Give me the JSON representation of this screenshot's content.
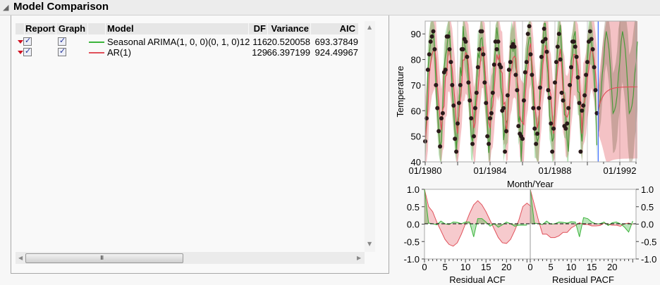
{
  "header": {
    "title": "Model Comparison",
    "disclosure_icon": "triangle-open"
  },
  "table": {
    "columns": [
      "Report",
      "Graph",
      "Model",
      "DF",
      "Variance",
      "AIC"
    ],
    "rows": [
      {
        "report": true,
        "graph": true,
        "color": "#3cb43c",
        "model": "Seasonal ARIMA(1, 0, 0)(0, 1, 0)12",
        "df": "116",
        "variance": "20.520058",
        "aic": "693.37849"
      },
      {
        "report": true,
        "graph": true,
        "color": "#e0505a",
        "model": "AR(1)",
        "df": "129",
        "variance": "66.397199",
        "aic": "924.49967"
      }
    ],
    "scroll": {
      "grip": "III"
    }
  },
  "chart_data": [
    {
      "type": "line",
      "xlabel": "Month/Year",
      "ylabel": "Temperature",
      "xticks": [
        "01/1980",
        "01/1984",
        "01/1988",
        "01/1992"
      ],
      "yticks": [
        40,
        50,
        60,
        70,
        80,
        90
      ],
      "ylim": [
        40,
        95
      ],
      "xlim": [
        "01/1980",
        "07/1993"
      ],
      "forecast_start": "01/1991",
      "observed_start": "01/1980",
      "observed": [
        48,
        57,
        76,
        82,
        87,
        89,
        91,
        84,
        70,
        61,
        52,
        46,
        57,
        59,
        75,
        76,
        89,
        89,
        84,
        79,
        70,
        62,
        49,
        44,
        55,
        63,
        70,
        84,
        84,
        88,
        87,
        81,
        71,
        64,
        57,
        47,
        50,
        61,
        67,
        77,
        84,
        91,
        91,
        82,
        71,
        63,
        50,
        47,
        57,
        59,
        67,
        78,
        87,
        84,
        87,
        78,
        77,
        60,
        61,
        44,
        52,
        66,
        76,
        79,
        85,
        86,
        85,
        74,
        68,
        54,
        51,
        50,
        49,
        64,
        75,
        79,
        90,
        93,
        82,
        74,
        61,
        53,
        47,
        51,
        61,
        69,
        81,
        87,
        92,
        88,
        83,
        68,
        65,
        55,
        44,
        53,
        71,
        79,
        85,
        90,
        80,
        67,
        64,
        54,
        53,
        55,
        61,
        70,
        77,
        87,
        87,
        85,
        81,
        73,
        63,
        44,
        60,
        62,
        66,
        74,
        79,
        87,
        91,
        88,
        84,
        77,
        68,
        59
      ],
      "series": [
        {
          "name": "Seasonal ARIMA(1, 0, 0)(0, 1, 0)12",
          "color": "#3cb43c"
        },
        {
          "name": "AR(1)",
          "color": "#e0505a"
        }
      ],
      "point_color": "#2a1a1a",
      "forecast_line_color": "#3366ff"
    },
    {
      "type": "area",
      "xlabel": "Residual ACF",
      "xticks": [
        0,
        5,
        10,
        15,
        20
      ],
      "ylim": [
        -1,
        1
      ],
      "yticks": [
        "1.0",
        "0.5",
        "0.0",
        "-0.5",
        "-1.0"
      ],
      "series": [
        {
          "name": "AR(1)",
          "color": "#e0505a",
          "values": [
            1,
            0.5,
            0.35,
            0.05,
            -0.2,
            -0.45,
            -0.6,
            -0.65,
            -0.55,
            -0.3,
            0.0,
            0.3,
            0.55,
            0.67,
            0.55,
            0.35,
            0.1,
            -0.15,
            -0.4,
            -0.55,
            -0.57,
            -0.45,
            -0.2,
            0.1,
            0.5,
            0.6,
            0.5
          ]
        },
        {
          "name": "Seasonal ARIMA(1, 0, 0)(0, 1, 0)12",
          "color": "#3cb43c",
          "values": [
            1,
            0.02,
            0,
            -0.03,
            0.08,
            0.0,
            -0.02,
            0.05,
            0.04,
            0.0,
            0.05,
            0.05,
            -0.38,
            0.15,
            0.15,
            0.05,
            -0.07,
            0.0,
            -0.1,
            -0.03,
            0.05,
            0.0,
            -0.07,
            -0.04,
            -0.04,
            -0.04
          ]
        }
      ]
    },
    {
      "type": "area",
      "xlabel": "Residual PACF",
      "xticks": [
        0,
        5,
        10,
        15,
        20
      ],
      "ylim": [
        -1,
        1
      ],
      "yticks": [
        "1.0",
        "0.5",
        "0.0",
        "-0.5",
        "-1.0"
      ],
      "series": [
        {
          "name": "AR(1)",
          "color": "#e0505a",
          "values": [
            1,
            0.55,
            0.1,
            -0.3,
            -0.3,
            -0.4,
            -0.4,
            -0.35,
            -0.25,
            -0.25,
            -0.12,
            -0.05,
            0.03,
            -0.02,
            -0.02,
            -0.06,
            -0.06,
            -0.05,
            0.02,
            -0.02,
            -0.04,
            -0.04,
            -0.07,
            0.0,
            0.02,
            -0.02
          ]
        },
        {
          "name": "Seasonal ARIMA(1, 0, 0)(0, 1, 0)12",
          "color": "#3cb43c",
          "values": [
            1,
            0.02,
            0,
            -0.02,
            0.08,
            -0.01,
            0,
            0.05,
            0.04,
            0.02,
            0.06,
            0.05,
            -0.38,
            0.18,
            0.15,
            0.05,
            0,
            0,
            0.05,
            -0.05,
            0.03,
            0.05,
            0,
            -0.1,
            -0.24,
            0.08
          ]
        }
      ]
    }
  ]
}
